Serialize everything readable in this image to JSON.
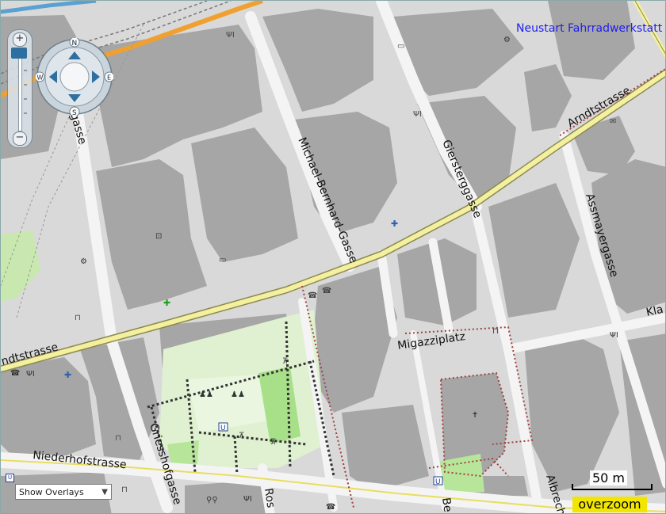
{
  "map": {
    "street_labels": [
      {
        "id": "michael-bernhard-gasse",
        "text": "Michael-Bernhard-Gasse"
      },
      {
        "id": "giersterggasse",
        "text": "Giersterggasse"
      },
      {
        "id": "arndtstrasse-east",
        "text": "Arndtstrasse"
      },
      {
        "id": "arndtstrasse-west",
        "text": "ndtstrasse"
      },
      {
        "id": "assmayergasse",
        "text": "Assmayergasse"
      },
      {
        "id": "migazziplatz",
        "text": "Migazziplatz"
      },
      {
        "id": "niederhofstrasse",
        "text": "Niederhofstrasse"
      },
      {
        "id": "griesshofgasse",
        "text": "Griesshofgasse"
      },
      {
        "id": "gasse-west",
        "text": "gasse"
      },
      {
        "id": "albrecht",
        "text": "Albrech"
      },
      {
        "id": "klaeger",
        "text": "Kla"
      },
      {
        "id": "ros",
        "text": "Ros"
      },
      {
        "id": "be",
        "text": "Be"
      }
    ],
    "poi_label": "Neustart Fahrradwerkstatt",
    "compass": {
      "n": "N",
      "s": "S",
      "e": "E",
      "w": "W"
    },
    "zoom": {
      "in_label": "+",
      "out_label": "−"
    },
    "scale_label": "50 m",
    "overzoom_label": "overzoom",
    "overlay_select": {
      "value": "Show Overlays",
      "options": [
        "Show Overlays"
      ]
    },
    "transit_marker": "U",
    "colors": {
      "background": "#d9d9d9",
      "building": "#a6a6a6",
      "street": "#f4f4f4",
      "main_road": "#f4f0a0",
      "park": "#d7f0c0",
      "park_dark": "#b7e69b",
      "label_link": "#1e1ef0",
      "overzoom": "#f2e600"
    },
    "icons": [
      "restaurant-icon",
      "parking-icon",
      "hospital-icon",
      "pharmacy-icon",
      "post-icon",
      "telephone-icon",
      "bench-icon",
      "church-icon",
      "toilets-icon",
      "bicycle-shop-icon",
      "subway-icon",
      "picnic-icon",
      "shelter-icon",
      "playground-icon"
    ]
  }
}
